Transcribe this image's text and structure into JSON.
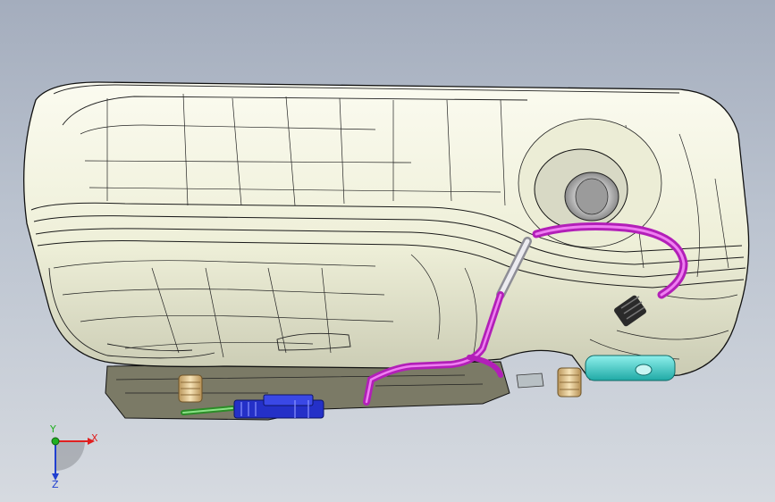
{
  "viewport": {
    "background_top": "#a4adbd",
    "background_bottom": "#d6dae0"
  },
  "model": {
    "tank_shell_color": "#f1f2de",
    "edge_color": "#111111",
    "vent_tube_color": "#d23ad8",
    "filler_pipe_color": "#c9c9d0",
    "connector_color": "#2a2a2a",
    "fitting_color": "#e7cf9a",
    "green_tube_color": "#3db338",
    "blue_coupling_color": "#2430c8",
    "cyan_part_color": "#3fd3cf",
    "dark_base_color": "#6a6a58",
    "filler_neck_icon": "filler-neck-icon",
    "fuel_pump_connector_icon": "connector-icon"
  },
  "triad": {
    "x_label": "X",
    "y_label": "Y",
    "z_label": "Z",
    "x_color": "#e02020",
    "y_color": "#20b020",
    "z_color": "#2040d0"
  }
}
